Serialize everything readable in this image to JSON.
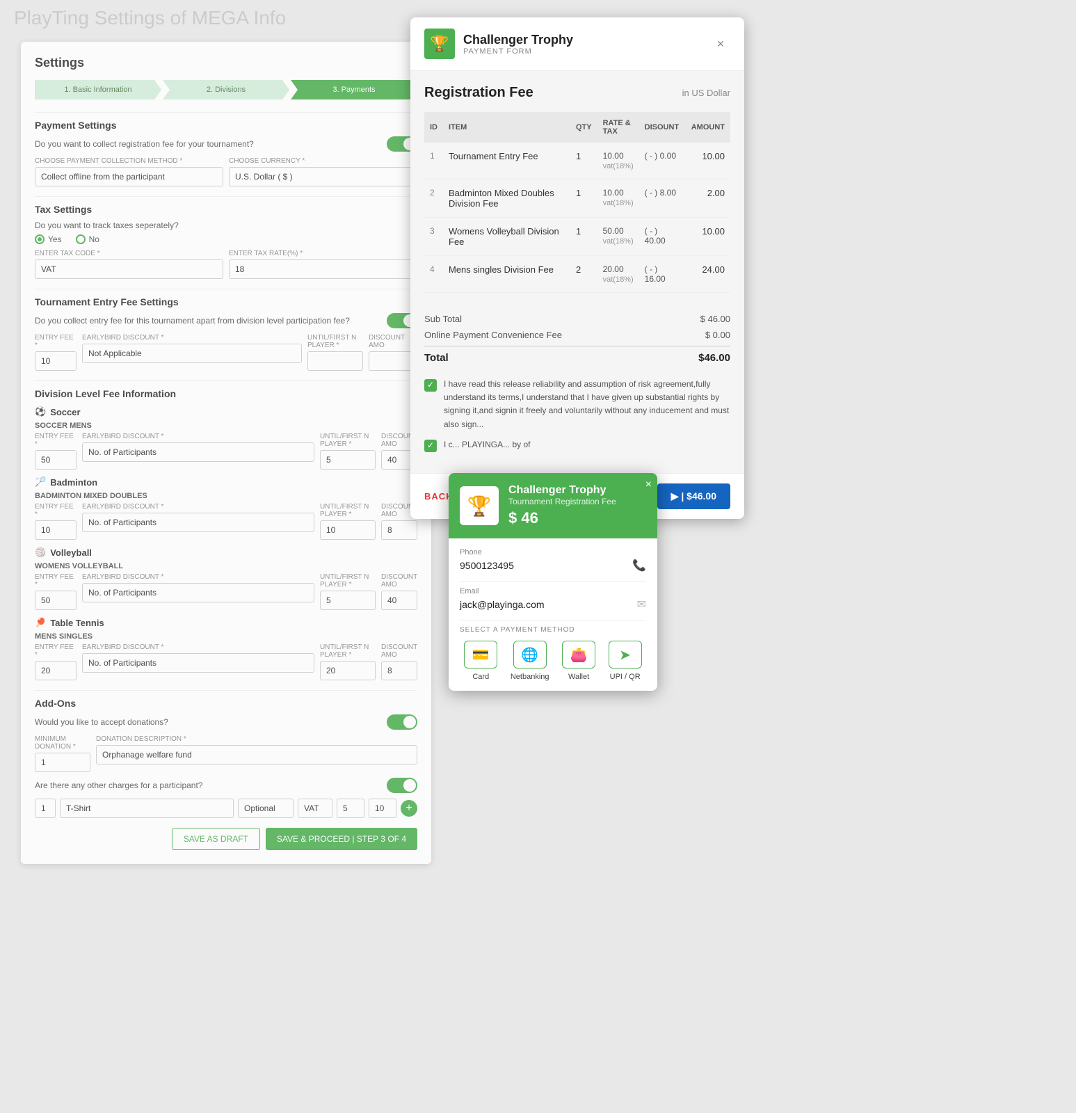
{
  "background": {
    "blur_text": "PlayTing Settings of MEGA Info"
  },
  "settings": {
    "title": "Settings",
    "steps": [
      {
        "label": "1. Basic Information",
        "active": false
      },
      {
        "label": "2. Divisions",
        "active": false
      },
      {
        "label": "3. Payments",
        "active": true
      }
    ],
    "payment_settings": {
      "title": "Payment Settings",
      "question1": "Do you want to collect registration fee for your tournament?",
      "toggle1": "Yes",
      "collection_method_label": "CHOOSE PAYMENT COLLECTION METHOD *",
      "collection_method_value": "Collect offline from the participant",
      "currency_label": "CHOOSE CURRENCY *",
      "currency_value": "U.S. Dollar ( $ )"
    },
    "tax_settings": {
      "title": "Tax Settings",
      "question": "Do you want to track taxes seperately?",
      "yes_label": "Yes",
      "no_label": "No",
      "tax_code_label": "ENTER TAX CODE *",
      "tax_code_value": "VAT",
      "tax_rate_label": "ENTER TAX RATE(%) *",
      "tax_rate_value": "18"
    },
    "entry_fee_settings": {
      "title": "Tournament Entry Fee Settings",
      "question": "Do you collect entry fee for this tournament apart from division level participation fee?",
      "toggle": "Yes",
      "entry_fee_label": "ENTRY FEE *",
      "entry_fee_value": "10",
      "earlybird_label": "EARLYBIRD DISCOUNT *",
      "earlybird_value": "Not Applicable",
      "until_label": "UNTIL/FIRST N PLAYER *",
      "until_value": "",
      "discount_label": "DISCOUNT AMO"
    },
    "division_fees": {
      "title": "Division Level Fee Information",
      "sports": [
        {
          "name": "Soccer",
          "icon": "⚽",
          "subsection": "SOCCER MENS",
          "entry_fee": "50",
          "earlybird": "No. of Participants",
          "until": "5",
          "discount": "40"
        },
        {
          "name": "Badminton",
          "icon": "🏸",
          "subsection": "BADMINTON MIXED DOUBLES",
          "entry_fee": "10",
          "earlybird": "No. of Participants",
          "until": "10",
          "discount": "8"
        },
        {
          "name": "Volleyball",
          "icon": "🏐",
          "subsection": "WOMENS VOLLEYBALL",
          "entry_fee": "50",
          "earlybird": "No. of Participants",
          "until": "5",
          "discount": "40"
        },
        {
          "name": "Table Tennis",
          "icon": "🏓",
          "subsection": "MENS SINGLES",
          "entry_fee": "20",
          "earlybird": "No. of Participants",
          "until": "20",
          "discount": "8"
        }
      ]
    },
    "addons": {
      "title": "Add-Ons",
      "donations_question": "Would you like to accept donations?",
      "donations_toggle": "Yes",
      "min_donation_label": "MINIMUM DONATION *",
      "min_donation_value": "1",
      "donation_desc_label": "DONATION DESCRIPTION *",
      "donation_desc_value": "Orphanage welfare fund",
      "other_charges_question": "Are there any other charges for a participant?",
      "other_charges_toggle": "Yes",
      "addon_qty": "1",
      "addon_item": "T-Shirt",
      "addon_optional": "Optional",
      "addon_vat": "VAT",
      "addon_val1": "5",
      "addon_val2": "10"
    },
    "buttons": {
      "save_draft": "SAVE AS DRAFT",
      "proceed": "SAVE & PROCEED | STEP 3 OF 4"
    }
  },
  "payment_modal": {
    "title": "Challenger Trophy",
    "subtitle": "PAYMENT FORM",
    "close_label": "×",
    "registration_fee_title": "Registration Fee",
    "currency_label": "in US Dollar",
    "table": {
      "headers": [
        "ID",
        "ITEM",
        "QTY",
        "RATE & TAX",
        "DISOUNT",
        "AMOUNT"
      ],
      "rows": [
        {
          "id": "1",
          "item": "Tournament Entry Fee",
          "qty": "1",
          "rate": "10.00\nvat(18%)",
          "discount": "( - ) 0.00",
          "amount": "10.00"
        },
        {
          "id": "2",
          "item": "Badminton Mixed Doubles Division Fee",
          "qty": "1",
          "rate": "10.00\nvat(18%)",
          "discount": "( - ) 8.00",
          "amount": "2.00"
        },
        {
          "id": "3",
          "item": "Womens Volleyball Division Fee",
          "qty": "1",
          "rate": "50.00\nvat(18%)",
          "discount": "( - ) 40.00",
          "amount": "10.00"
        },
        {
          "id": "4",
          "item": "Mens singles Division Fee",
          "qty": "2",
          "rate": "20.00\nvat(18%)",
          "discount": "( - ) 16.00",
          "amount": "24.00"
        }
      ]
    },
    "subtotal_label": "Sub Total",
    "subtotal_value": "$ 46.00",
    "convenience_fee_label": "Online Payment Convenience Fee",
    "convenience_fee_value": "$ 0.00",
    "total_label": "Total",
    "total_value": "$46.00",
    "agreement1": "I have read this release reliability and assumption of risk agreement,fully understand its terms,I understand that I have given up substantial rights by signing it,and signin it freely and voluntarily without any inducement and must also sign...",
    "agreement2": "I c... PLAYINGA... by of",
    "back_label": "BACK",
    "pay_label": "▶ | $46.00"
  },
  "payment_popup": {
    "title": "Challenger Trophy",
    "subtitle": "Tournament Registration Fee",
    "amount": "$ 46",
    "close_label": "×",
    "phone_label": "Phone",
    "phone_value": "9500123495",
    "email_label": "Email",
    "email_value": "jack@playinga.com",
    "select_method_label": "SELECT A PAYMENT METHOD",
    "methods": [
      {
        "icon": "💳",
        "label": "Card"
      },
      {
        "icon": "🌐",
        "label": "Netbanking"
      },
      {
        "icon": "👛",
        "label": "Wallet"
      },
      {
        "icon": "➤",
        "label": "UPI / QR"
      }
    ]
  }
}
